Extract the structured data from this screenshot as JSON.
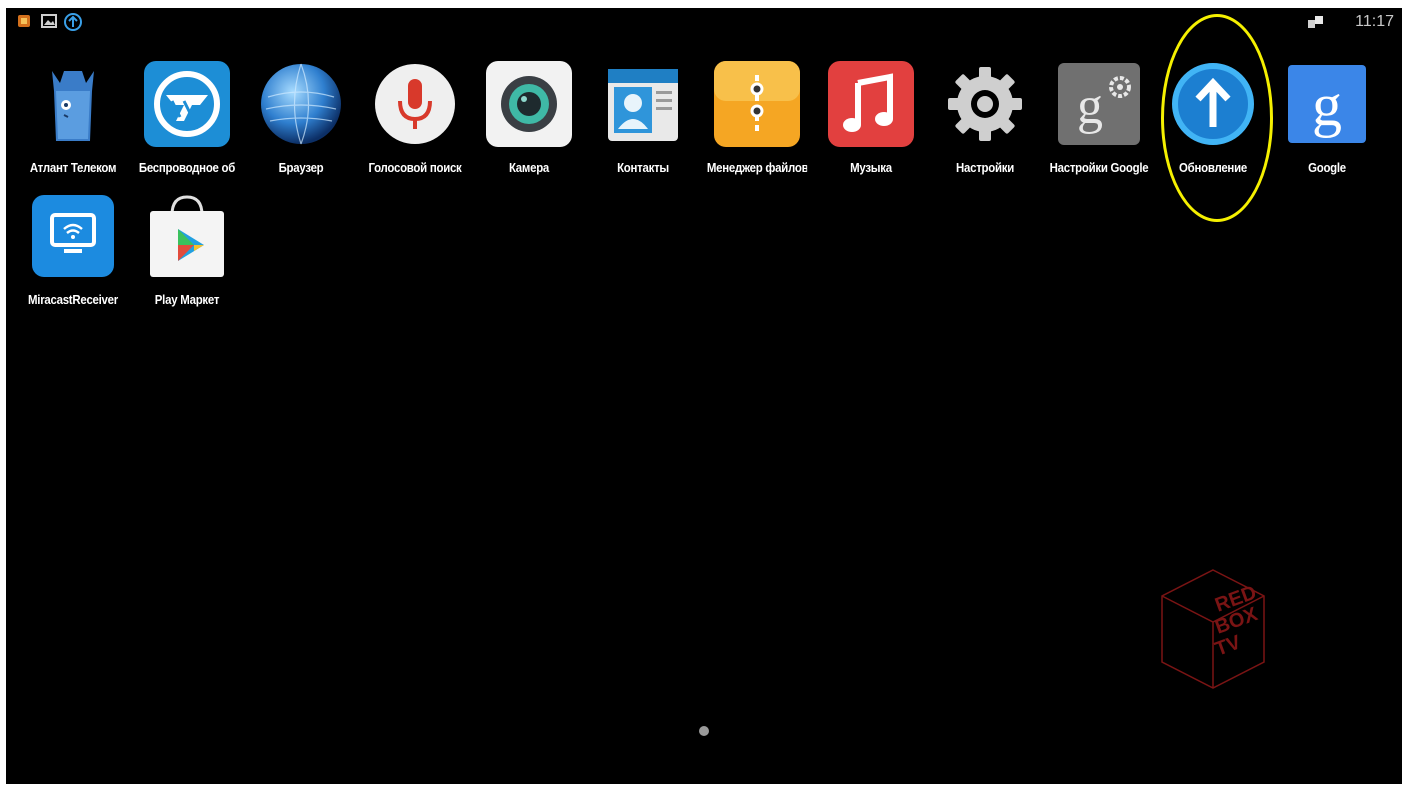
{
  "status_bar": {
    "time": "11:17",
    "left_icons": [
      "app-notification-icon",
      "image-icon",
      "update-arrow-icon"
    ],
    "right_icons": [
      "network-icon"
    ]
  },
  "apps": [
    {
      "label": "Атлант Телеком",
      "icon": "atlant-telecom-icon"
    },
    {
      "label": "Беспроводное об",
      "icon": "wireless-icon"
    },
    {
      "label": "Браузер",
      "icon": "globe-icon"
    },
    {
      "label": "Голосовой поиск",
      "icon": "microphone-icon"
    },
    {
      "label": "Камера",
      "icon": "camera-icon"
    },
    {
      "label": "Контакты",
      "icon": "contacts-icon"
    },
    {
      "label": "Менеджер файлов",
      "icon": "file-manager-icon"
    },
    {
      "label": "Музыка",
      "icon": "music-icon"
    },
    {
      "label": "Настройки",
      "icon": "settings-gear-icon"
    },
    {
      "label": "Настройки Google",
      "icon": "google-settings-icon"
    },
    {
      "label": "Обновление",
      "icon": "update-arrow-icon"
    },
    {
      "label": "Google",
      "icon": "google-icon"
    },
    {
      "label": "MiracastReceiver",
      "icon": "miracast-icon"
    },
    {
      "label": "Play Маркет",
      "icon": "play-store-icon"
    }
  ],
  "watermark": {
    "lines": [
      "RED",
      "BOX",
      "TV"
    ]
  },
  "colors": {
    "background": "#000000",
    "highlight": "#f5f000",
    "label": "#ffffff"
  }
}
